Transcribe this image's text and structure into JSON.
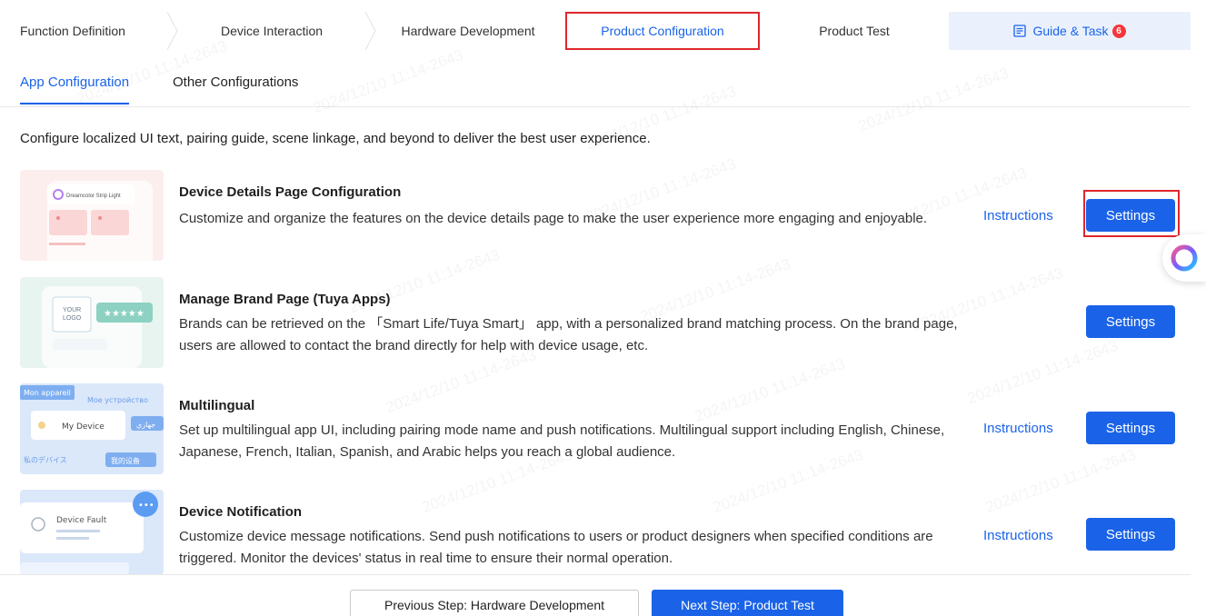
{
  "steps": [
    {
      "label": "Function Definition"
    },
    {
      "label": "Device Interaction"
    },
    {
      "label": "Hardware Development"
    },
    {
      "label": "Product Configuration"
    },
    {
      "label": "Product Test"
    }
  ],
  "guide": {
    "label": "Guide & Task",
    "count": "6"
  },
  "subtabs": [
    "App Configuration",
    "Other Configurations"
  ],
  "intro": "Configure localized UI text, pairing guide, scene linkage, and beyond to deliver the best user experience.",
  "cards": [
    {
      "title": "Device Details Page Configuration",
      "desc": "Customize and organize the features on the device details page to make the user experience more engaging and enjoyable.",
      "instructions": "Instructions",
      "settings": "Settings",
      "thumb_text": "Dreamcolor Strip Light"
    },
    {
      "title": "Manage Brand Page (Tuya Apps)",
      "desc": "Brands can be retrieved on the 「Smart Life/Tuya Smart」 app, with a personalized brand matching process. On the brand page, users are allowed to contact the brand directly for help with device usage, etc.",
      "settings": "Settings",
      "thumb_text": "YOUR LOGO"
    },
    {
      "title": "Multilingual",
      "desc": "Set up multilingual app UI, including pairing mode name and push notifications. Multilingual support including English, Chinese, Japanese, French, Italian, Spanish, and Arabic helps you reach a global audience.",
      "instructions": "Instructions",
      "settings": "Settings",
      "thumb_labels": [
        "Mon appareil",
        "Мое устройство",
        "My Device",
        "جهازي",
        "私のデバイス",
        "我的设备"
      ]
    },
    {
      "title": "Device Notification",
      "desc": "Customize device message notifications. Send push notifications to users or product designers when specified conditions are triggered. Monitor the devices' status in real time to ensure their normal operation.",
      "instructions": "Instructions",
      "settings": "Settings",
      "thumb_text": "Device Fault"
    }
  ],
  "footer": {
    "prev": "Previous Step: Hardware Development",
    "next": "Next Step: Product Test"
  },
  "watermark": "2024/12/10 11:14-2643",
  "colors": {
    "accent": "#1a63e8",
    "highlight": "#e0262c",
    "badge": "#f5363b"
  }
}
